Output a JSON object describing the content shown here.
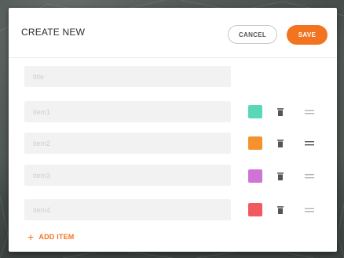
{
  "dialog": {
    "title": "CREATE NEW",
    "cancel_label": "CANCEL",
    "save_label": "SAVE"
  },
  "form": {
    "title_placeholder": "title",
    "items": [
      {
        "placeholder": "item1",
        "color": "#5ad7b4",
        "color_icon": "color-swatch",
        "delete_icon": "trash-icon",
        "drag_icon": "drag-handle-icon"
      },
      {
        "placeholder": "item2",
        "color": "#f6922e",
        "color_icon": "color-swatch",
        "delete_icon": "trash-icon",
        "drag_icon": "drag-handle-icon"
      },
      {
        "placeholder": "item3",
        "color": "#cf74d6",
        "color_icon": "color-swatch",
        "delete_icon": "trash-icon",
        "drag_icon": "drag-handle-icon"
      },
      {
        "placeholder": "item4",
        "color": "#f05a5f",
        "color_icon": "color-swatch",
        "delete_icon": "trash-icon",
        "drag_icon": "drag-handle-icon"
      }
    ],
    "add_item_label": "ADD ITEM",
    "add_item_icon": "+"
  },
  "colors": {
    "accent": "#f27420"
  }
}
